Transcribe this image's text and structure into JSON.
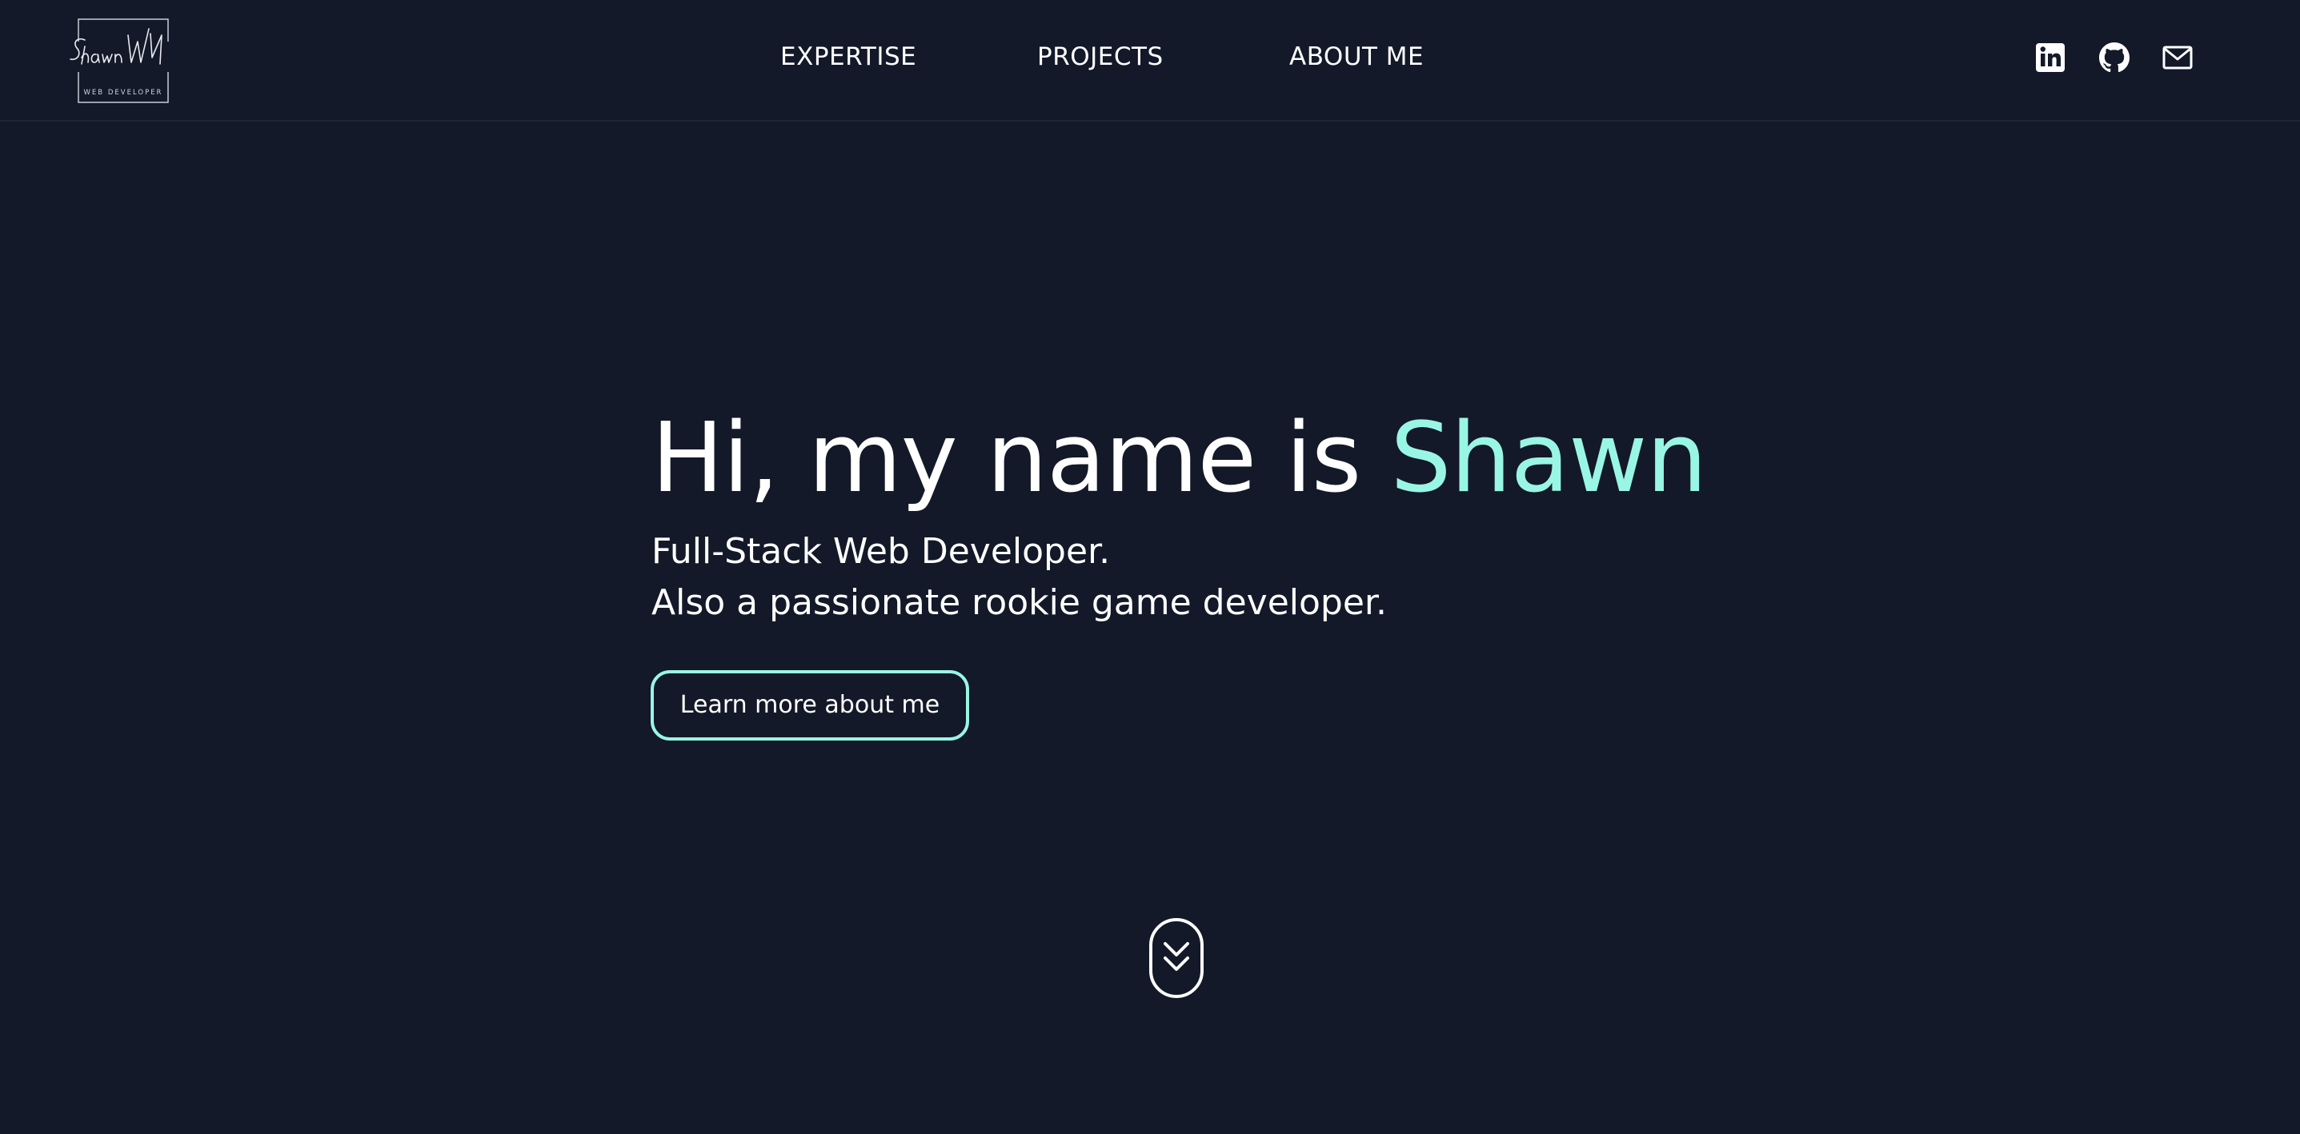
{
  "header": {
    "logo": {
      "signature": "Shawn Wu",
      "tagline": "WEB DEVELOPER"
    },
    "nav": [
      {
        "label": "EXPERTISE"
      },
      {
        "label": "PROJECTS"
      },
      {
        "label": "ABOUT ME"
      }
    ],
    "social": [
      {
        "icon": "linkedin-icon"
      },
      {
        "icon": "github-icon"
      },
      {
        "icon": "mail-icon"
      }
    ]
  },
  "hero": {
    "title_prefix": "Hi, my name is ",
    "title_name": "Shawn",
    "subtitle_line1": "Full-Stack Web Developer.",
    "subtitle_line2": "Also a passionate rookie game developer.",
    "cta_label": "Learn more about me"
  },
  "scroll": {
    "icon": "double-chevron-down-icon"
  },
  "colors": {
    "background": "#131928",
    "accent": "#99f6e4",
    "text": "#ffffff"
  }
}
